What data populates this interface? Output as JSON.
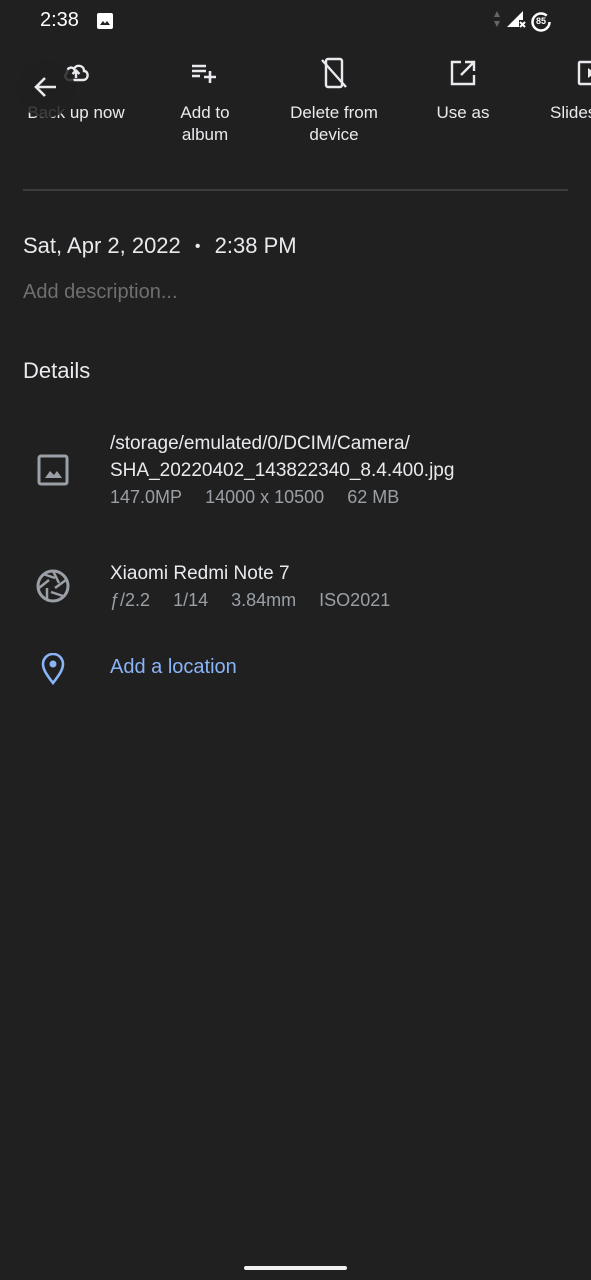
{
  "status_bar": {
    "time": "2:38",
    "battery_level": "85",
    "icons": [
      "image-notification-icon",
      "data-arrows-icon",
      "signal-no-service-icon",
      "battery-saver-icon"
    ]
  },
  "actions": [
    {
      "label": "Back up now",
      "icon": "cloud-upload-icon"
    },
    {
      "label": "Add to album",
      "icon": "playlist-add-icon"
    },
    {
      "label": "Delete from device",
      "icon": "phone-off-icon"
    },
    {
      "label": "Use as",
      "icon": "open-in-new-icon"
    },
    {
      "label": "Slideshow",
      "icon": "slideshow-icon"
    }
  ],
  "back_button": {
    "icon": "arrow-back-icon"
  },
  "info": {
    "date": "Sat, Apr 2, 2022",
    "separator": "•",
    "time": "2:38 PM",
    "description_placeholder": "Add description..."
  },
  "details": {
    "heading": "Details",
    "file": {
      "path": "/storage/emulated/0/DCIM/Camera/",
      "name": "SHA_20220402_143822340_8.4.400.jpg",
      "megapixels": "147.0MP",
      "resolution": "14000 x 10500",
      "size": "62 MB"
    },
    "camera": {
      "model": "Xiaomi Redmi Note 7",
      "aperture": "ƒ/2.2",
      "shutter": "1/14",
      "focal_length": "3.84mm",
      "iso": "ISO2021"
    },
    "location": {
      "label": "Add a location"
    }
  },
  "colors": {
    "background": "#202020",
    "link": "#8ab4f8"
  }
}
